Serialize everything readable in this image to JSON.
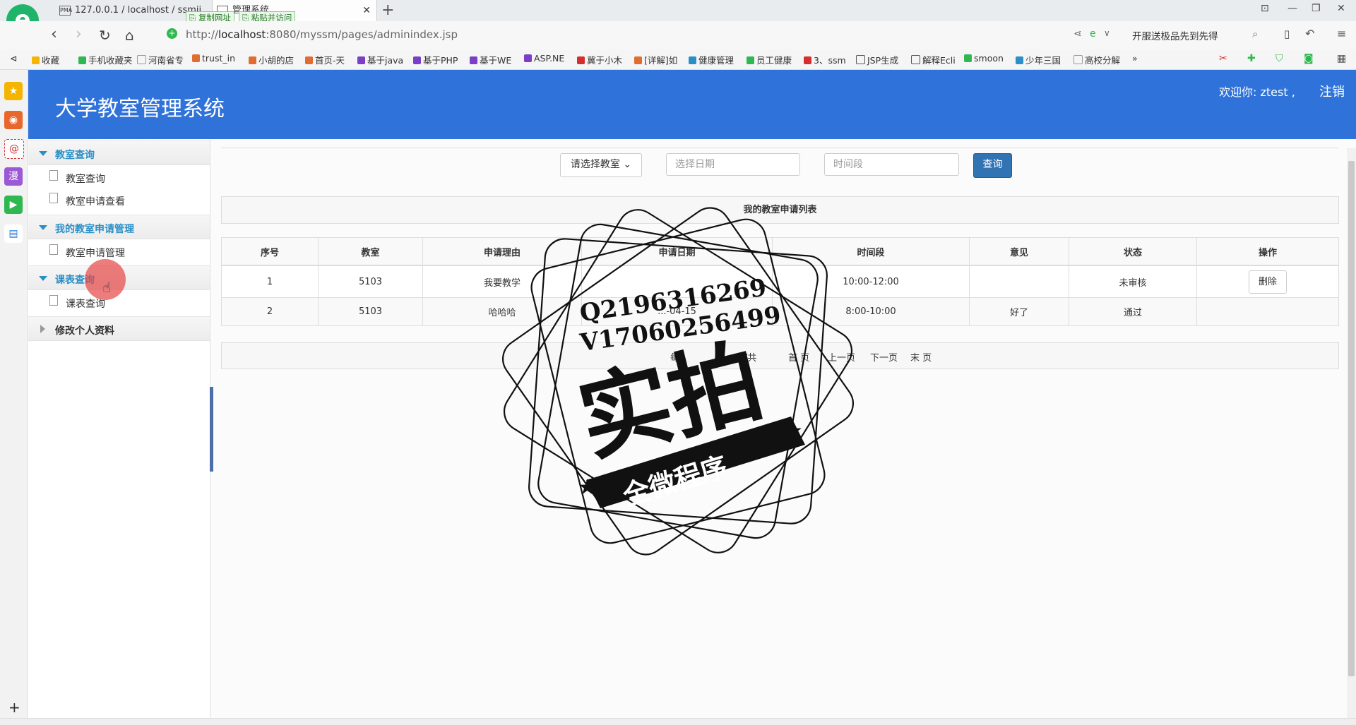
{
  "browser": {
    "tab1_title": "127.0.0.1 / localhost / ssmji...",
    "tab2_title": "管理系统",
    "copy_url": "复制网址",
    "paste_visit": "粘贴并访问",
    "url_prefix": "http://",
    "url_host": "localhost",
    "url_rest": ":8080/myssm/pages/adminindex.jsp",
    "search_hint": "开服送极品先到先得",
    "bookmarks": [
      "收藏",
      "手机收藏夹",
      "河南省专",
      "trust_in",
      "小胡的店",
      "首页-天",
      "基于java",
      "基于PHP",
      "基于WE",
      "ASP.NE",
      "冀于小木",
      "[详解]如",
      "健康管理",
      "员工健康",
      "3、ssm",
      "JSP生成",
      "解释Ecli",
      "smoon",
      "少年三国",
      "高校分解"
    ]
  },
  "header": {
    "system_name": "大学教室管理系统",
    "welcome": "欢迎你: ztest ,",
    "logout": "注销"
  },
  "menu": {
    "group1": "教室查询",
    "group1_items": [
      "教室查询",
      "教室申请查看"
    ],
    "group2": "我的教室申请管理",
    "group2_items": [
      "教室申请管理"
    ],
    "group3": "课表查询",
    "group3_items": [
      "课表查询"
    ],
    "group4": "修改个人资料"
  },
  "filter": {
    "room_select": "请选择教室",
    "date_placeholder": "选择日期",
    "period_placeholder": "时间段",
    "query_button": "查询"
  },
  "list": {
    "title": "我的教室申请列表",
    "columns": [
      "序号",
      "教室",
      "申请理由",
      "申请日期",
      "时间段",
      "意见",
      "状态",
      "操作"
    ],
    "rows": [
      {
        "no": "1",
        "room": "5103",
        "reason": "我要教学",
        "date": "",
        "period": "10:00-12:00",
        "opinion": "",
        "status": "未审核",
        "action": "删除"
      },
      {
        "no": "2",
        "room": "5103",
        "reason": "哈哈哈",
        "date": "...-04-15",
        "period": "8:00-10:00",
        "opinion": "好了",
        "status": "通过",
        "action": ""
      }
    ]
  },
  "pager": {
    "per_page": "每",
    "pages": "页/共",
    "first": "首 页",
    "prev": "上一页",
    "next": "下一页",
    "last": "末 页"
  },
  "watermark": {
    "line1": "Q2196316269",
    "line2": "V17060256499",
    "big": "实拍",
    "ribbon": "全微程序"
  },
  "colors": {
    "header": "#2f72d9",
    "accent": "#2a8fc7",
    "button": "#3273b4"
  }
}
